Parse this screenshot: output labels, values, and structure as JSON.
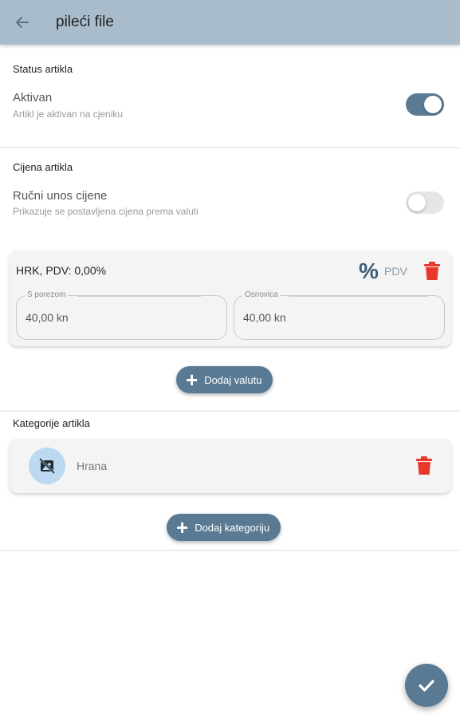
{
  "header": {
    "title": "pileći file",
    "back_icon": "arrow-left-icon"
  },
  "status": {
    "section_title": "Status artikla",
    "label": "Aktivan",
    "description": "Artikl je aktivan na cjeniku",
    "toggle_on": true
  },
  "price": {
    "section_title": "Cijena artikla",
    "manual_label": "Ručni unos cijene",
    "manual_description": "Prikazuje se postavljena cijena prema valuti",
    "manual_toggle_on": false,
    "currency_card": {
      "label": "HRK, PDV: 0,00%",
      "percent_symbol": "%",
      "pdv_label": "PDV",
      "with_tax_label": "S porezom",
      "with_tax_value": "40,00 kn",
      "base_label": "Osnovica",
      "base_value": "40,00 kn"
    },
    "add_currency_label": "Dodaj valutu"
  },
  "categories": {
    "section_title": "Kategorije artikla",
    "items": [
      {
        "name": "Hrana",
        "icon": "no-image-icon"
      }
    ],
    "add_category_label": "Dodaj kategoriju"
  },
  "colors": {
    "appbar": "#a9bccb",
    "accent": "#5a7a93",
    "delete": "#e8382c"
  },
  "fab_icon": "check-icon"
}
